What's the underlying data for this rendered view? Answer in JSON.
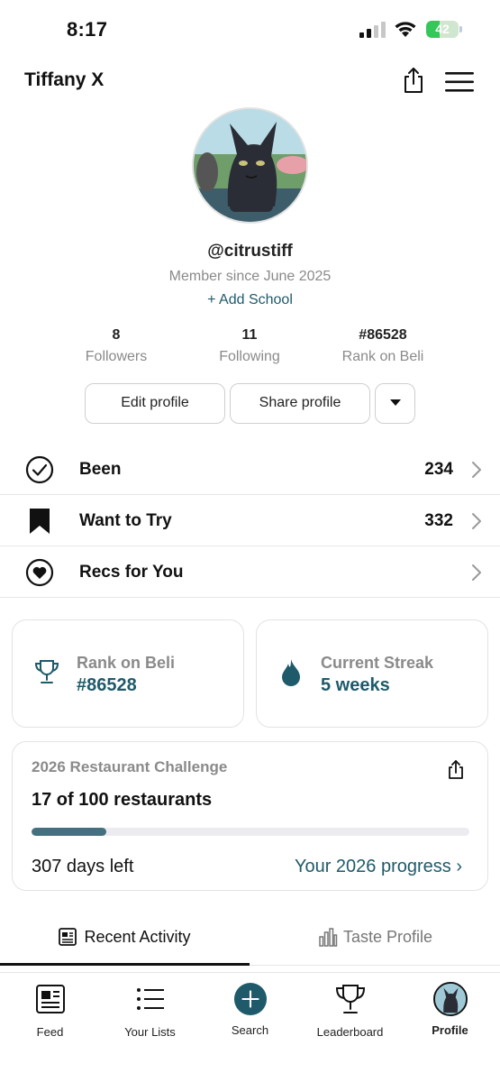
{
  "status_bar": {
    "time": "8:17",
    "battery": "42",
    "battery_level": 0.42,
    "colors": {
      "battery": "#34c759"
    }
  },
  "header": {
    "name": "Tiffany X",
    "share_icon": "share-icon",
    "menu_icon": "hamburger-menu-icon"
  },
  "profile": {
    "handle": "@citrustiff",
    "member_since": "Member since June 2025",
    "add_school": "+ Add School",
    "stats": [
      {
        "value": "8",
        "label": "Followers"
      },
      {
        "value": "11",
        "label": "Following"
      },
      {
        "value": "#86528",
        "label": "Rank on Beli"
      }
    ],
    "buttons": {
      "edit": "Edit profile",
      "share": "Share profile",
      "more_icon": "caret-down-icon"
    }
  },
  "lists": [
    {
      "label": "Been",
      "count": "234",
      "icon": "check-circle-icon"
    },
    {
      "label": "Want to Try",
      "count": "332",
      "icon": "bookmark-icon"
    },
    {
      "label": "Recs for You",
      "count": "",
      "icon": "heart-circle-icon"
    }
  ],
  "cards": {
    "rank": {
      "title": "Rank on Beli",
      "value": "#86528",
      "icon": "trophy-icon"
    },
    "streak": {
      "title": "Current Streak",
      "value": "5 weeks",
      "icon": "flame-icon"
    }
  },
  "challenge": {
    "title": "2026 Restaurant Challenge",
    "count_text": "17 of 100 restaurants",
    "progress_fraction": 0.17,
    "days_left": "307 days left",
    "progress_link": "Your 2026 progress ›",
    "share_icon": "share-icon"
  },
  "tabs": [
    {
      "label": "Recent Activity",
      "icon": "newspaper-icon",
      "active": true
    },
    {
      "label": "Taste Profile",
      "icon": "bar-chart-icon",
      "active": false
    }
  ],
  "bottom_nav": [
    {
      "label": "Feed",
      "icon": "newspaper-icon"
    },
    {
      "label": "Your Lists",
      "icon": "list-icon"
    },
    {
      "label": "Search",
      "icon": "plus-circle-icon"
    },
    {
      "label": "Leaderboard",
      "icon": "trophy-icon"
    },
    {
      "label": "Profile",
      "icon": "avatar-icon",
      "active": true
    }
  ],
  "colors": {
    "accent": "#1f5a6a",
    "progress": "#45707f",
    "muted": "#8a8a8a"
  }
}
